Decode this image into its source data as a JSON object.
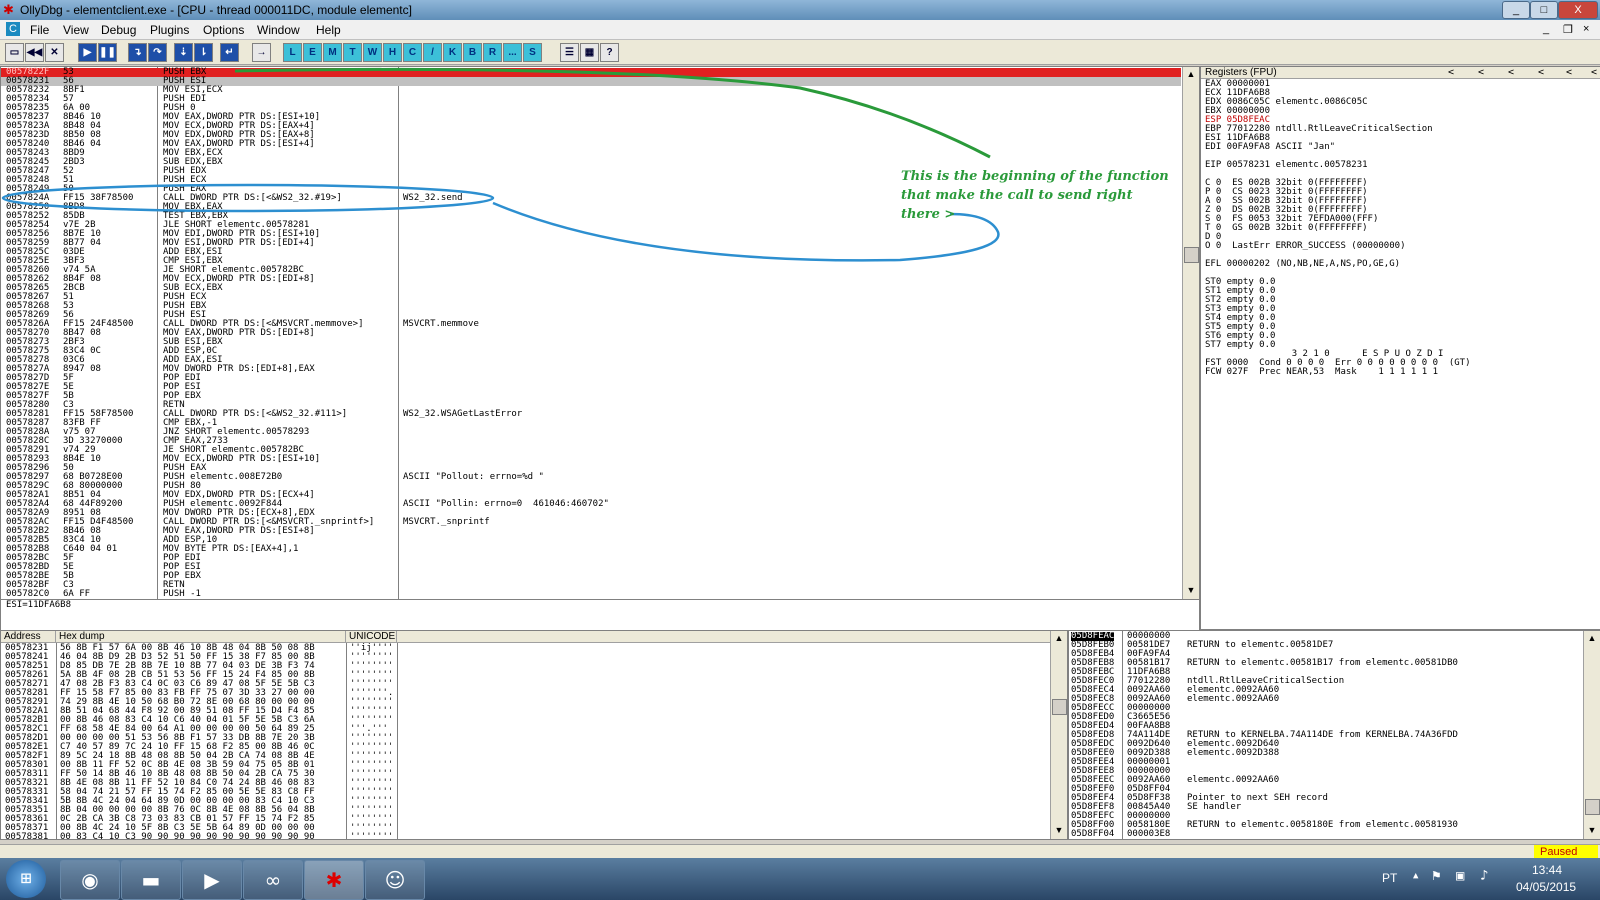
{
  "window": {
    "title": "OllyDbg - elementclient.exe - [CPU - thread 000011DC, module elementc]",
    "minimize": "_",
    "maximize": "□",
    "close": "X"
  },
  "menu": [
    "File",
    "View",
    "Debug",
    "Plugins",
    "Options",
    "Window",
    "Help"
  ],
  "toolbar_letters": [
    "L",
    "E",
    "M",
    "T",
    "W",
    "H",
    "C",
    "/",
    "K",
    "B",
    "R",
    "...",
    "S"
  ],
  "disasm_rows": [
    {
      "addr": "0057822F",
      "hex": "53",
      "asm": "PUSH EBX",
      "cmt": "",
      "sel": "red"
    },
    {
      "addr": "00578231",
      "hex": "56",
      "asm": "PUSH ESI",
      "cmt": "",
      "sel": "eip"
    },
    {
      "addr": "00578232",
      "hex": "8BF1",
      "asm": "MOV ESI,ECX",
      "cmt": ""
    },
    {
      "addr": "00578234",
      "hex": "57",
      "asm": "PUSH EDI",
      "cmt": ""
    },
    {
      "addr": "00578235",
      "hex": "6A 00",
      "asm": "PUSH 0",
      "cmt": ""
    },
    {
      "addr": "00578237",
      "hex": "8B46 10",
      "asm": "MOV EAX,DWORD PTR DS:[ESI+10]",
      "cmt": ""
    },
    {
      "addr": "0057823A",
      "hex": "8B48 04",
      "asm": "MOV ECX,DWORD PTR DS:[EAX+4]",
      "cmt": ""
    },
    {
      "addr": "0057823D",
      "hex": "8B50 08",
      "asm": "MOV EDX,DWORD PTR DS:[EAX+8]",
      "cmt": ""
    },
    {
      "addr": "00578240",
      "hex": "8B46 04",
      "asm": "MOV EAX,DWORD PTR DS:[ESI+4]",
      "cmt": ""
    },
    {
      "addr": "00578243",
      "hex": "8BD9",
      "asm": "MOV EBX,ECX",
      "cmt": ""
    },
    {
      "addr": "00578245",
      "hex": "2BD3",
      "asm": "SUB EDX,EBX",
      "cmt": ""
    },
    {
      "addr": "00578247",
      "hex": "52",
      "asm": "PUSH EDX",
      "cmt": ""
    },
    {
      "addr": "00578248",
      "hex": "51",
      "asm": "PUSH ECX",
      "cmt": ""
    },
    {
      "addr": "00578249",
      "hex": "50",
      "asm": "PUSH EAX",
      "cmt": ""
    },
    {
      "addr": "0057824A",
      "hex": "FF15 38F78500",
      "asm": "CALL DWORD PTR DS:[<&WS2_32.#19>]",
      "cmt": "WS2_32.send"
    },
    {
      "addr": "00578250",
      "hex": "8BD8",
      "asm": "MOV EBX,EAX",
      "cmt": ""
    },
    {
      "addr": "00578252",
      "hex": "85DB",
      "asm": "TEST EBX,EBX",
      "cmt": ""
    },
    {
      "addr": "00578254",
      "hex": "v7E 2B",
      "asm": "JLE SHORT elementc.00578281",
      "cmt": ""
    },
    {
      "addr": "00578256",
      "hex": "8B7E 10",
      "asm": "MOV EDI,DWORD PTR DS:[ESI+10]",
      "cmt": ""
    },
    {
      "addr": "00578259",
      "hex": "8B77 04",
      "asm": "MOV ESI,DWORD PTR DS:[EDI+4]",
      "cmt": ""
    },
    {
      "addr": "0057825C",
      "hex": "03DE",
      "asm": "ADD EBX,ESI",
      "cmt": ""
    },
    {
      "addr": "0057825E",
      "hex": "3BF3",
      "asm": "CMP ESI,EBX",
      "cmt": ""
    },
    {
      "addr": "00578260",
      "hex": "v74 5A",
      "asm": "JE SHORT elementc.005782BC",
      "cmt": ""
    },
    {
      "addr": "00578262",
      "hex": "8B4F 08",
      "asm": "MOV ECX,DWORD PTR DS:[EDI+8]",
      "cmt": ""
    },
    {
      "addr": "00578265",
      "hex": "2BCB",
      "asm": "SUB ECX,EBX",
      "cmt": ""
    },
    {
      "addr": "00578267",
      "hex": "51",
      "asm": "PUSH ECX",
      "cmt": ""
    },
    {
      "addr": "00578268",
      "hex": "53",
      "asm": "PUSH EBX",
      "cmt": ""
    },
    {
      "addr": "00578269",
      "hex": "56",
      "asm": "PUSH ESI",
      "cmt": ""
    },
    {
      "addr": "0057826A",
      "hex": "FF15 24F48500",
      "asm": "CALL DWORD PTR DS:[<&MSVCRT.memmove>]",
      "cmt": "MSVCRT.memmove"
    },
    {
      "addr": "00578270",
      "hex": "8B47 08",
      "asm": "MOV EAX,DWORD PTR DS:[EDI+8]",
      "cmt": ""
    },
    {
      "addr": "00578273",
      "hex": "2BF3",
      "asm": "SUB ESI,EBX",
      "cmt": ""
    },
    {
      "addr": "00578275",
      "hex": "83C4 0C",
      "asm": "ADD ESP,0C",
      "cmt": ""
    },
    {
      "addr": "00578278",
      "hex": "03C6",
      "asm": "ADD EAX,ESI",
      "cmt": ""
    },
    {
      "addr": "0057827A",
      "hex": "8947 08",
      "asm": "MOV DWORD PTR DS:[EDI+8],EAX",
      "cmt": ""
    },
    {
      "addr": "0057827D",
      "hex": "5F",
      "asm": "POP EDI",
      "cmt": ""
    },
    {
      "addr": "0057827E",
      "hex": "5E",
      "asm": "POP ESI",
      "cmt": ""
    },
    {
      "addr": "0057827F",
      "hex": "5B",
      "asm": "POP EBX",
      "cmt": ""
    },
    {
      "addr": "00578280",
      "hex": "C3",
      "asm": "RETN",
      "cmt": ""
    },
    {
      "addr": "00578281",
      "hex": "FF15 58F78500",
      "asm": "CALL DWORD PTR DS:[<&WS2_32.#111>]",
      "cmt": "WS2_32.WSAGetLastError"
    },
    {
      "addr": "00578287",
      "hex": "83FB FF",
      "asm": "CMP EBX,-1",
      "cmt": ""
    },
    {
      "addr": "0057828A",
      "hex": "v75 07",
      "asm": "JNZ SHORT elementc.00578293",
      "cmt": ""
    },
    {
      "addr": "0057828C",
      "hex": "3D 33270000",
      "asm": "CMP EAX,2733",
      "cmt": ""
    },
    {
      "addr": "00578291",
      "hex": "v74 29",
      "asm": "JE SHORT elementc.005782BC",
      "cmt": ""
    },
    {
      "addr": "00578293",
      "hex": "8B4E 10",
      "asm": "MOV ECX,DWORD PTR DS:[ESI+10]",
      "cmt": ""
    },
    {
      "addr": "00578296",
      "hex": "50",
      "asm": "PUSH EAX",
      "cmt": ""
    },
    {
      "addr": "00578297",
      "hex": "68 B0728E00",
      "asm": "PUSH elementc.008E72B0",
      "cmt": "ASCII \"Pollout: errno=%d \""
    },
    {
      "addr": "0057829C",
      "hex": "68 80000000",
      "asm": "PUSH 80",
      "cmt": ""
    },
    {
      "addr": "005782A1",
      "hex": "8B51 04",
      "asm": "MOV EDX,DWORD PTR DS:[ECX+4]",
      "cmt": ""
    },
    {
      "addr": "005782A4",
      "hex": "68 44F89200",
      "asm": "PUSH elementc.0092F844",
      "cmt": "ASCII \"Pollin: errno=0  461046:460702\""
    },
    {
      "addr": "005782A9",
      "hex": "8951 08",
      "asm": "MOV DWORD PTR DS:[ECX+8],EDX",
      "cmt": ""
    },
    {
      "addr": "005782AC",
      "hex": "FF15 D4F48500",
      "asm": "CALL DWORD PTR DS:[<&MSVCRT._snprintf>]",
      "cmt": "MSVCRT._snprintf"
    },
    {
      "addr": "005782B2",
      "hex": "8B46 08",
      "asm": "MOV EAX,DWORD PTR DS:[ESI+8]",
      "cmt": ""
    },
    {
      "addr": "005782B5",
      "hex": "83C4 10",
      "asm": "ADD ESP,10",
      "cmt": ""
    },
    {
      "addr": "005782B8",
      "hex": "C640 04 01",
      "asm": "MOV BYTE PTR DS:[EAX+4],1",
      "cmt": ""
    },
    {
      "addr": "005782BC",
      "hex": "5F",
      "asm": "POP EDI",
      "cmt": ""
    },
    {
      "addr": "005782BD",
      "hex": "5E",
      "asm": "POP ESI",
      "cmt": ""
    },
    {
      "addr": "005782BE",
      "hex": "5B",
      "asm": "POP EBX",
      "cmt": ""
    },
    {
      "addr": "005782BF",
      "hex": "C3",
      "asm": "RETN",
      "cmt": ""
    },
    {
      "addr": "005782C0",
      "hex": "6A FF",
      "asm": "PUSH -1",
      "cmt": ""
    }
  ],
  "info_line": "ESI=11DFA6B8",
  "annotation": {
    "line1": "This is the beginning of the function",
    "line2": "that make the call to send right",
    "line3": "there >"
  },
  "registers": {
    "header": "Registers (FPU)",
    "nav": [
      "<",
      "<",
      "<",
      "<",
      "<",
      "<"
    ],
    "lines": [
      {
        "t": "EAX 00000001"
      },
      {
        "t": "ECX 11DFA6B8"
      },
      {
        "t": "EDX 0086C05C elementc.0086C05C"
      },
      {
        "t": "EBX 00000000"
      },
      {
        "t": "ESP 05D8FEAC",
        "red": true
      },
      {
        "t": "EBP 77012280 ntdll.RtlLeaveCriticalSection"
      },
      {
        "t": "ESI 11DFA6B8"
      },
      {
        "t": "EDI 00FA9FA8 ASCII \"Jan\""
      },
      {
        "t": ""
      },
      {
        "t": "EIP 00578231 elementc.00578231"
      },
      {
        "t": ""
      },
      {
        "t": "C 0  ES 002B 32bit 0(FFFFFFFF)"
      },
      {
        "t": "P 0  CS 0023 32bit 0(FFFFFFFF)"
      },
      {
        "t": "A 0  SS 002B 32bit 0(FFFFFFFF)"
      },
      {
        "t": "Z 0  DS 002B 32bit 0(FFFFFFFF)"
      },
      {
        "t": "S 0  FS 0053 32bit 7EFDA000(FFF)"
      },
      {
        "t": "T 0  GS 002B 32bit 0(FFFFFFFF)"
      },
      {
        "t": "D 0"
      },
      {
        "t": "O 0  LastErr ERROR_SUCCESS (00000000)"
      },
      {
        "t": ""
      },
      {
        "t": "EFL 00000202 (NO,NB,NE,A,NS,PO,GE,G)"
      },
      {
        "t": ""
      },
      {
        "t": "ST0 empty 0.0"
      },
      {
        "t": "ST1 empty 0.0"
      },
      {
        "t": "ST2 empty 0.0"
      },
      {
        "t": "ST3 empty 0.0"
      },
      {
        "t": "ST4 empty 0.0"
      },
      {
        "t": "ST5 empty 0.0"
      },
      {
        "t": "ST6 empty 0.0"
      },
      {
        "t": "ST7 empty 0.0"
      },
      {
        "t": "                3 2 1 0      E S P U O Z D I"
      },
      {
        "t": "FST 0000  Cond 0 0 0 0  Err 0 0 0 0 0 0 0 0  (GT)"
      },
      {
        "t": "FCW 027F  Prec NEAR,53  Mask    1 1 1 1 1 1"
      }
    ]
  },
  "dump": {
    "headers": [
      "Address",
      "Hex dump",
      "UNICODE"
    ],
    "rows": [
      {
        "a": "00578231",
        "h": "56 8B F1 57 6A 00 8B 46 10 8B 48 04 8B 50 08 8B",
        "u": "''ij''''"
      },
      {
        "a": "00578241",
        "h": "46 04 8B D9 2B D3 52 51 50 FF 15 38 F7 85 00 8B",
        "u": "''''''''"
      },
      {
        "a": "00578251",
        "h": "D8 85 DB 7E 2B 8B 7E 10 8B 77 04 03 DE 3B F3 74",
        "u": "''''''''"
      },
      {
        "a": "00578261",
        "h": "5A 8B 4F 08 2B CB 51 53 56 FF 15 24 F4 85 00 8B",
        "u": "''''''''"
      },
      {
        "a": "00578271",
        "h": "47 08 2B F3 83 C4 0C 03 C6 89 47 08 5F 5E 5B C3",
        "u": "''''''''"
      },
      {
        "a": "00578281",
        "h": "FF 15 58 F7 85 00 83 FB FF 75 07 3D 33 27 00 00",
        "u": "'''''''."
      },
      {
        "a": "00578291",
        "h": "74 29 8B 4E 10 50 68 B0 72 8E 00 68 80 00 00 00",
        "u": "''''''''"
      },
      {
        "a": "005782A1",
        "h": "8B 51 04 68 44 F8 92 00 89 51 08 FF 15 D4 F4 85",
        "u": "''''''''"
      },
      {
        "a": "005782B1",
        "h": "00 8B 46 08 83 C4 10 C6 40 04 01 5F 5E 5B C3 6A",
        "u": "''''''''"
      },
      {
        "a": "005782C1",
        "h": "FF 68 58 4E 84 00 64 A1 00 00 00 00 50 64 89 25",
        "u": "'''.'''"
      },
      {
        "a": "005782D1",
        "h": "00 00 00 00 51 53 56 8B F1 57 33 DB 8B 7E 20 3B",
        "u": "''''''''"
      },
      {
        "a": "005782E1",
        "h": "C7 40 57 89 7C 24 10 FF 15 68 F2 85 00 8B 46 0C",
        "u": "''''''''"
      },
      {
        "a": "005782F1",
        "h": "89 5C 24 18 8B 48 08 8B 50 04 2B CA 74 08 8B 4E",
        "u": "''''''''"
      },
      {
        "a": "00578301",
        "h": "00 8B 11 FF 52 0C 8B 4E 08 3B 59 04 75 05 8B 01",
        "u": "''''''''"
      },
      {
        "a": "00578311",
        "h": "FF 50 14 8B 46 10 8B 48 08 8B 50 04 2B CA 75 30",
        "u": "''''''''"
      },
      {
        "a": "00578321",
        "h": "8B 4E 08 8B 11 FF 52 10 84 C0 74 24 8B 46 08 83",
        "u": "''''''''"
      },
      {
        "a": "00578331",
        "h": "58 04 74 21 57 FF 15 74 F2 85 00 5E 5E 83 C8 FF",
        "u": "''''''''"
      },
      {
        "a": "00578341",
        "h": "5B 8B 4C 24 04 64 89 0D 00 00 00 00 83 C4 10 C3",
        "u": "''''''''"
      },
      {
        "a": "00578351",
        "h": "8B 04 00 00 00 00 8B 76 0C 8B 4E 08 8B 56 04 8B",
        "u": "''''''''"
      },
      {
        "a": "00578361",
        "h": "0C 2B CA 3B C8 73 03 83 CB 01 57 FF 15 74 F2 85",
        "u": "''''''''"
      },
      {
        "a": "00578371",
        "h": "00 8B 4C 24 10 5F 8B C3 5E 5B 64 89 0D 00 00 00",
        "u": "''''''''"
      },
      {
        "a": "00578381",
        "h": "00 83 C4 10 C3 90 90 90 90 90 90 90 90 90 90 90",
        "u": "''''''''"
      }
    ]
  },
  "stack": {
    "header": "05D8FEAC",
    "rows": [
      {
        "a": "05D8FEAC",
        "v": "00000000",
        "c": "",
        "sel": true
      },
      {
        "a": "05D8FEB0",
        "v": "00581DE7",
        "c": "RETURN to elementc.00581DE7"
      },
      {
        "a": "05D8FEB4",
        "v": "00FA9FA4",
        "c": ""
      },
      {
        "a": "05D8FEB8",
        "v": "00581B17",
        "c": "RETURN to elementc.00581B17 from elementc.00581DB0"
      },
      {
        "a": "05D8FEBC",
        "v": "11DFA6B8",
        "c": ""
      },
      {
        "a": "05D8FEC0",
        "v": "77012280",
        "c": "ntdll.RtlLeaveCriticalSection"
      },
      {
        "a": "05D8FEC4",
        "v": "0092AA60",
        "c": "elementc.0092AA60"
      },
      {
        "a": "05D8FEC8",
        "v": "0092AA60",
        "c": "elementc.0092AA60"
      },
      {
        "a": "05D8FECC",
        "v": "00000000",
        "c": ""
      },
      {
        "a": "05D8FED0",
        "v": "C3665E56",
        "c": ""
      },
      {
        "a": "05D8FED4",
        "v": "00FAA8B8",
        "c": ""
      },
      {
        "a": "05D8FED8",
        "v": "74A114DE",
        "c": "RETURN to KERNELBA.74A114DE from KERNELBA.74A36FDD"
      },
      {
        "a": "05D8FEDC",
        "v": "0092D640",
        "c": "elementc.0092D640"
      },
      {
        "a": "05D8FEE0",
        "v": "0092D388",
        "c": "elementc.0092D388"
      },
      {
        "a": "05D8FEE4",
        "v": "00000001",
        "c": ""
      },
      {
        "a": "05D8FEE8",
        "v": "00000000",
        "c": ""
      },
      {
        "a": "05D8FEEC",
        "v": "0092AA60",
        "c": "elementc.0092AA60"
      },
      {
        "a": "05D8FEF0",
        "v": "05D8FF04",
        "c": ""
      },
      {
        "a": "05D8FEF4",
        "v": "05D8FF38",
        "c": "Pointer to next SEH record"
      },
      {
        "a": "05D8FEF8",
        "v": "00845A40",
        "c": "SE handler"
      },
      {
        "a": "05D8FEFC",
        "v": "00000000",
        "c": ""
      },
      {
        "a": "05D8FF00",
        "v": "0058180E",
        "c": "RETURN to elementc.0058180E from elementc.00581930"
      },
      {
        "a": "05D8FF04",
        "v": "000003E8",
        "c": ""
      }
    ]
  },
  "status": {
    "state": "Paused"
  },
  "taskbar": {
    "lang": "PT",
    "time": "13:44",
    "date": "04/05/2015",
    "tray_up": "▲"
  },
  "colors": {
    "annotation_green": "#2a9a3a",
    "circle_blue": "#2d8fd0",
    "eip_highlight": "#c0c0c0",
    "paused_bg": "#ffff00"
  }
}
